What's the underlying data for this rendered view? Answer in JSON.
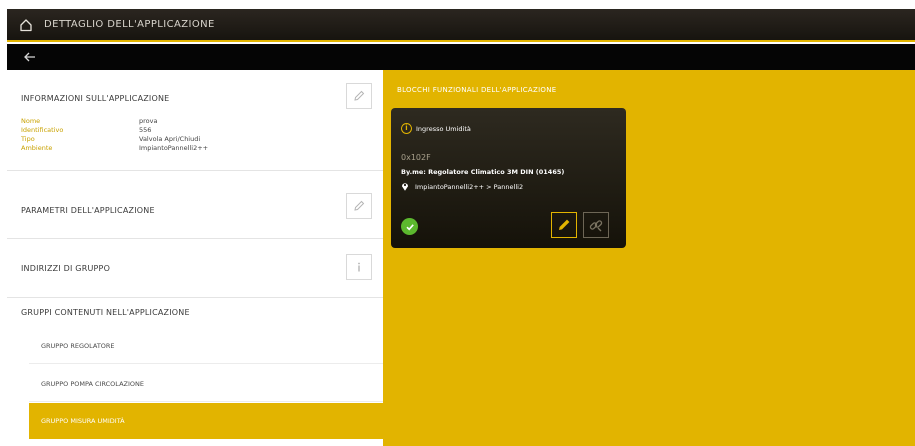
{
  "header": {
    "title": "DETTAGLIO DELL'APPLICAZIONE",
    "home_icon": "home-icon",
    "back_icon": "arrow-left-icon"
  },
  "left": {
    "info_section": {
      "title": "INFORMAZIONI SULL'APPLICAZIONE",
      "rows": [
        {
          "label": "Nome",
          "value": "prova"
        },
        {
          "label": "Identificativo",
          "value": "556"
        },
        {
          "label": "Tipo",
          "value": "Valvola Apri/Chiudi"
        },
        {
          "label": "Ambiente",
          "value": "ImpiantoPannelli2++"
        }
      ]
    },
    "params_section": {
      "title": "PARAMETRI DELL'APPLICAZIONE"
    },
    "group_addresses_section": {
      "title": "INDIRIZZI DI GRUPPO"
    },
    "groups_section": {
      "title": "GRUPPI CONTENUTI NELL'APPLICAZIONE",
      "items": [
        {
          "label": "GRUPPO REGOLATORE"
        },
        {
          "label": "GRUPPO POMPA CIRCOLAZIONE"
        },
        {
          "label": "GRUPPO MISURA UMIDITÀ"
        }
      ],
      "active_index": 2
    }
  },
  "right": {
    "title": "BLOCCHI FUNZIONALI DELL'APPLICAZIONE",
    "block": {
      "name": "Ingresso Umidità",
      "address": "0x102F",
      "device": "By.me: Regolatore Climatico 3M DIN (01465)",
      "location": "ImpiantoPannelli2++ > Pannelli2",
      "status": "ok"
    }
  },
  "colors": {
    "accent": "#e2b400",
    "dark_bar": "#050505",
    "status_ok": "#5cb82e"
  }
}
